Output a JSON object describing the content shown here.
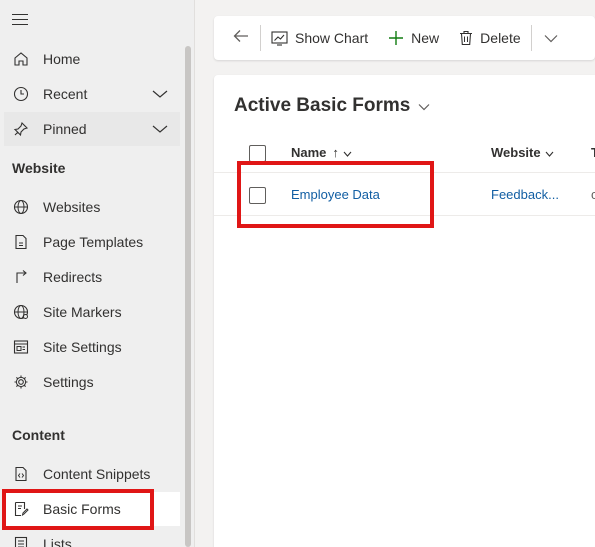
{
  "sidebar": {
    "items": [
      {
        "label": "Home",
        "icon": "home-icon"
      },
      {
        "label": "Recent",
        "icon": "clock-icon"
      },
      {
        "label": "Pinned",
        "icon": "pin-icon"
      }
    ],
    "sections": [
      {
        "title": "Website",
        "items": [
          {
            "label": "Websites",
            "icon": "globe-icon"
          },
          {
            "label": "Page Templates",
            "icon": "page-template-icon"
          },
          {
            "label": "Redirects",
            "icon": "redirect-icon"
          },
          {
            "label": "Site Markers",
            "icon": "globe-marker-icon"
          },
          {
            "label": "Site Settings",
            "icon": "site-settings-icon"
          },
          {
            "label": "Settings",
            "icon": "gear-icon"
          }
        ]
      },
      {
        "title": "Content",
        "items": [
          {
            "label": "Content Snippets",
            "icon": "snippet-icon"
          },
          {
            "label": "Basic Forms",
            "icon": "form-icon"
          },
          {
            "label": "Lists",
            "icon": "list-icon"
          }
        ]
      }
    ]
  },
  "toolbar": {
    "show_chart": "Show Chart",
    "new": "New",
    "delete": "Delete"
  },
  "view": {
    "title": "Active Basic Forms",
    "columns": {
      "name": "Name",
      "name_sort": "↑",
      "website": "Website",
      "truncated": "T"
    },
    "rows": [
      {
        "name": "Employee Data",
        "website": "Feedback...",
        "truncated": "c"
      }
    ]
  },
  "colors": {
    "accent": "#115ea3",
    "highlight": "#e01616",
    "green": "#107c10"
  }
}
